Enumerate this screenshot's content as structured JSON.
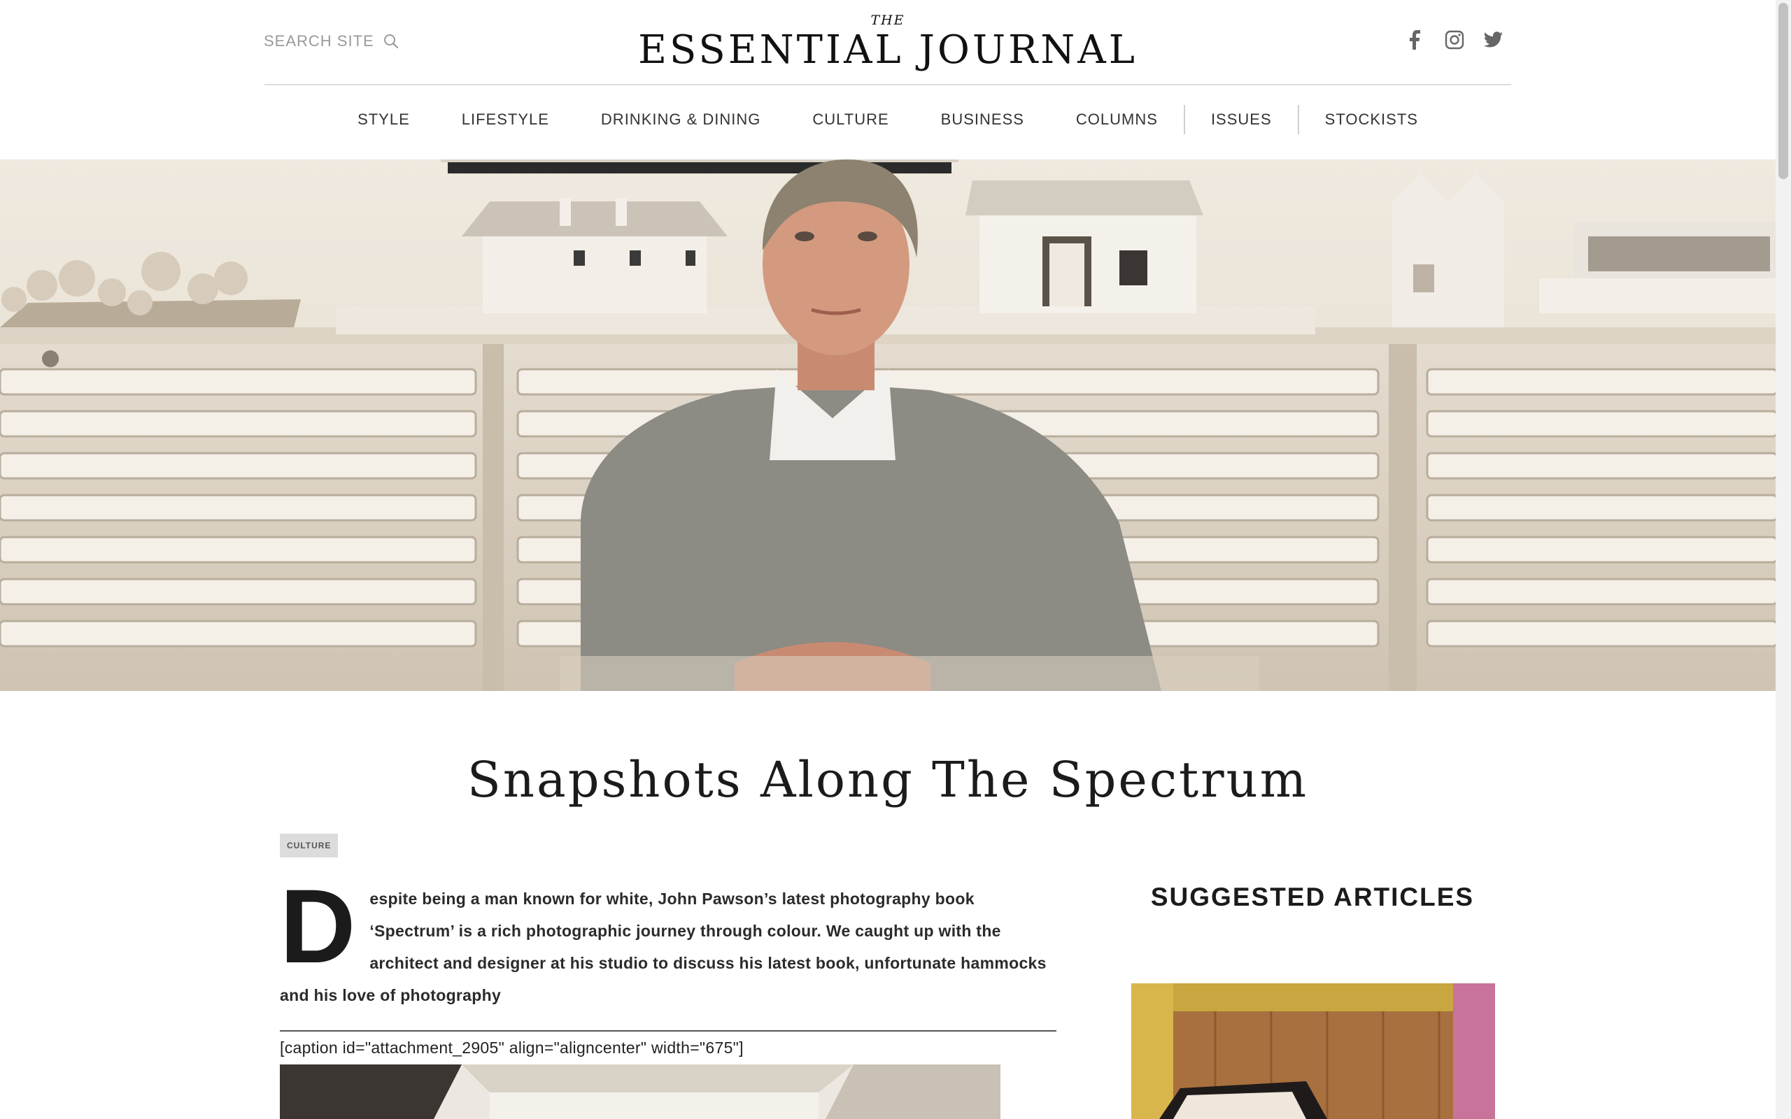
{
  "header": {
    "search_label": "SEARCH SITE",
    "logo_the": "THE",
    "logo_main": "ESSENTIAL JOURNAL",
    "social": [
      "facebook-icon",
      "instagram-icon",
      "twitter-icon"
    ]
  },
  "nav": {
    "items": [
      "STYLE",
      "LIFESTYLE",
      "DRINKING & DINING",
      "CULTURE",
      "BUSINESS",
      "COLUMNS",
      "ISSUES",
      "STOCKISTS"
    ]
  },
  "article": {
    "title": "Snapshots Along The Spectrum",
    "category": "CULTURE",
    "dropcap": "D",
    "intro": "espite being a man known for white, John Pawson’s latest photography book ‘Spectrum’ is a rich photographic journey through colour. We caught up with the architect and designer at his studio to discuss his latest book, unfortunate hammocks and his love of photography",
    "shortcode": "[caption id=\"attachment_2905\" align=\"aligncenter\" width=\"675\"]"
  },
  "sidebar": {
    "heading": "SUGGESTED ARTICLES"
  },
  "colors": {
    "background": "#ffffff",
    "text": "#222222",
    "muted": "#9a9a9a",
    "rule": "#dcdcdc",
    "tag_bg": "#dcdcdc"
  }
}
